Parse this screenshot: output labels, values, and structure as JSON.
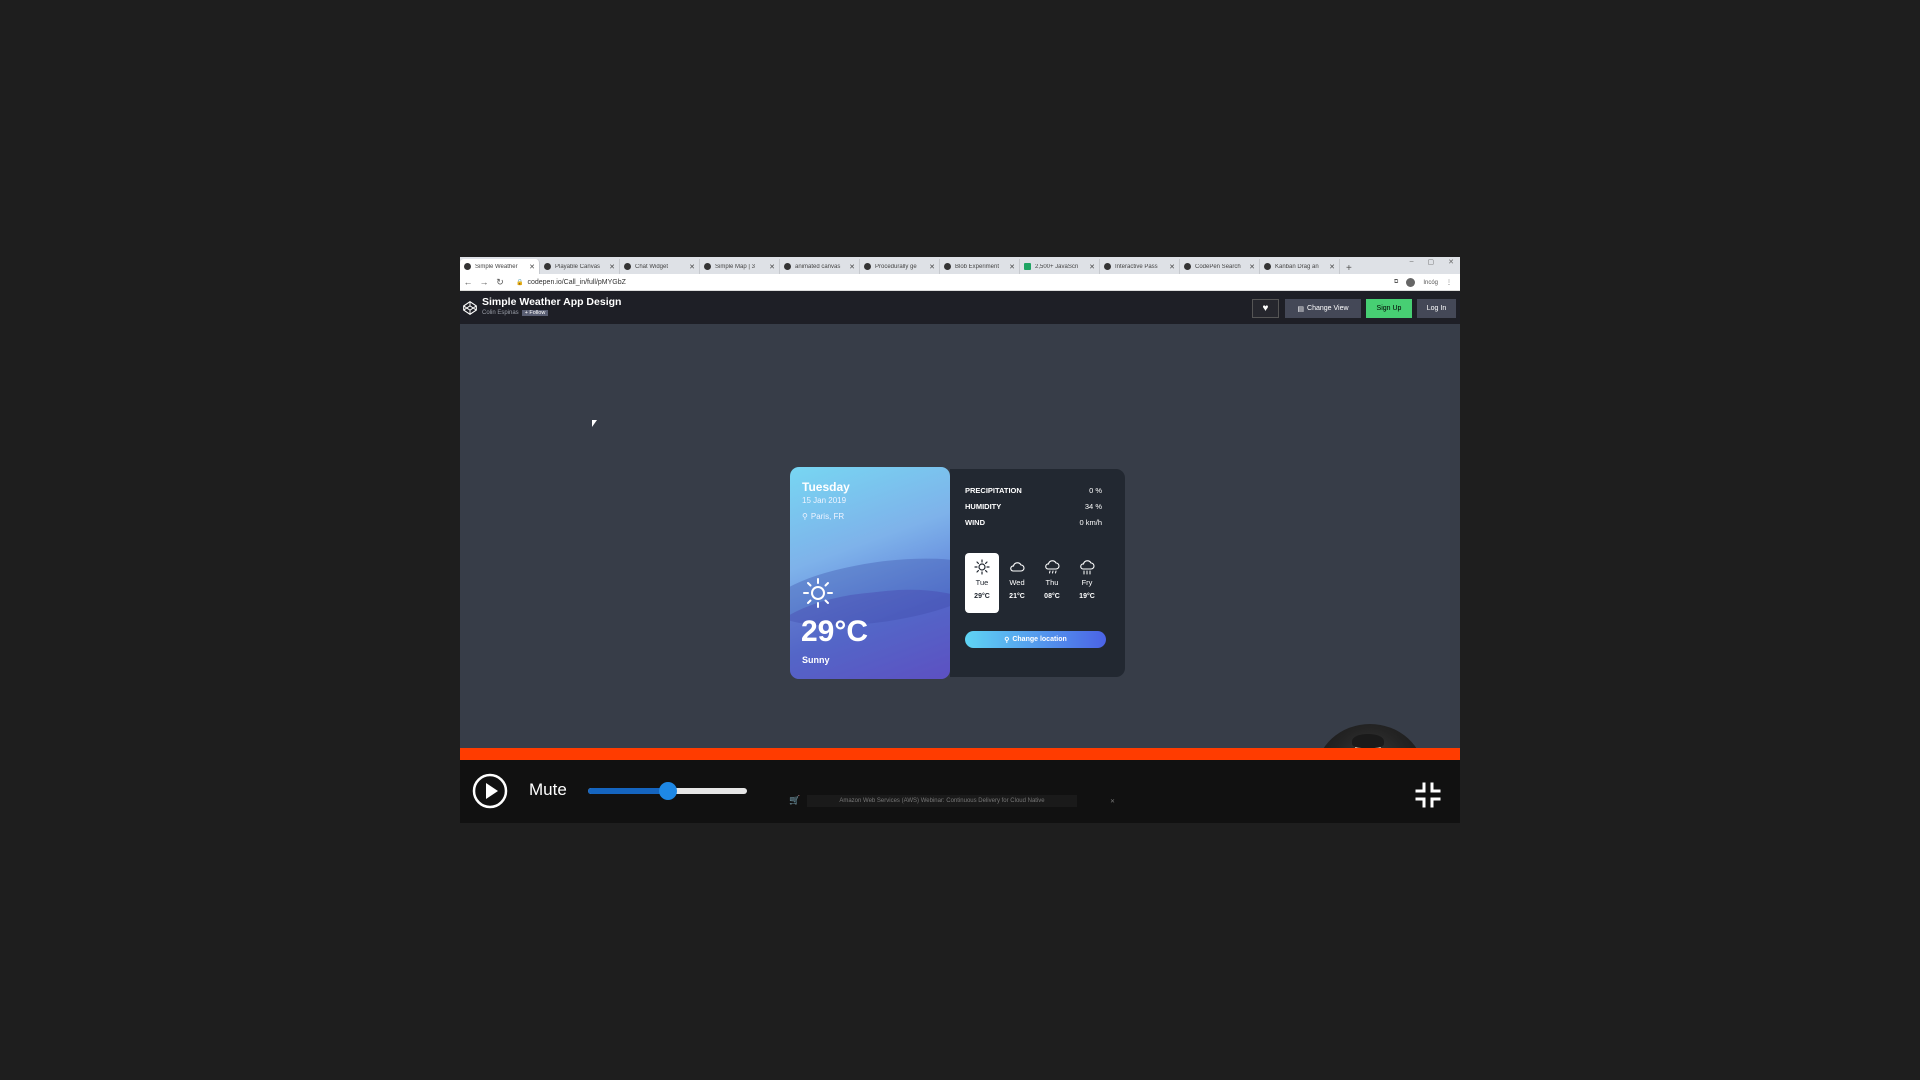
{
  "browser": {
    "tabs": [
      {
        "label": "Simple Weather",
        "active": true
      },
      {
        "label": "Playable Canvas"
      },
      {
        "label": "Chat Widget"
      },
      {
        "label": "Simple Map | 3"
      },
      {
        "label": "animated canvas"
      },
      {
        "label": "Procedurally ge"
      },
      {
        "label": "Blob Experiment"
      },
      {
        "label": "2,500+ JavaScri"
      },
      {
        "label": "Interactive Pass"
      },
      {
        "label": "CodePen Search"
      },
      {
        "label": "Kanban Drag an"
      }
    ],
    "new_tab": "+",
    "window_controls": [
      "–",
      "▢",
      "✕"
    ],
    "url": "codepen.io/Call_in/full/pMYGbZ",
    "profile": "Incóg"
  },
  "codepen": {
    "title": "Simple Weather App Design",
    "author": "Colin Espinas",
    "follow": "+ Follow",
    "change_view": "Change View",
    "sign_up": "Sign Up",
    "log_in": "Log In"
  },
  "weather": {
    "day": "Tuesday",
    "date": "15 Jan 2019",
    "location": "Paris, FR",
    "temp": "29°C",
    "desc": "Sunny",
    "details": [
      {
        "label": "PRECIPITATION",
        "value": "0 %"
      },
      {
        "label": "HUMIDITY",
        "value": "34 %"
      },
      {
        "label": "WIND",
        "value": "0 km/h"
      }
    ],
    "forecast": [
      {
        "day": "Tue",
        "temp": "29°C",
        "icon": "sun-icon"
      },
      {
        "day": "Wed",
        "temp": "21°C",
        "icon": "cloud-icon"
      },
      {
        "day": "Thu",
        "temp": "08°C",
        "icon": "cloud-rain-icon"
      },
      {
        "day": "Fry",
        "temp": "19°C",
        "icon": "cloud-storm-icon"
      }
    ],
    "change_location": "Change location"
  },
  "player": {
    "mute": "Mute",
    "volume": 0.5,
    "ad_text": "Amazon Web Services (AWS) Webinar: Continuous Delivery for Cloud Native"
  },
  "colors": {
    "progress": "#ff3c00",
    "signup": "#47cf73",
    "volume": "#1565c0"
  }
}
